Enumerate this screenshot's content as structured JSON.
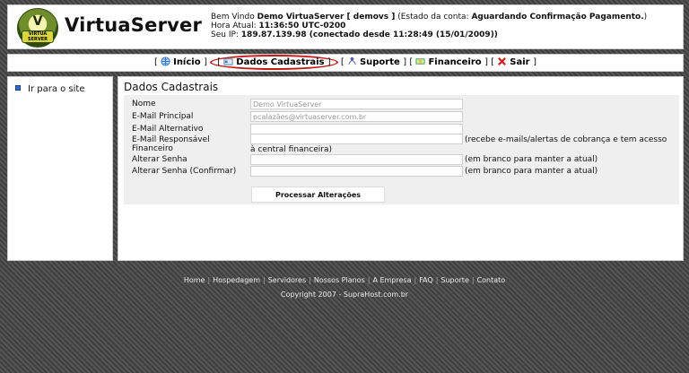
{
  "header": {
    "logo_badge": "VIRTUA SERVER",
    "logo_text": "VirtuaServer",
    "welcome_prefix": "Bem Vindo ",
    "user_name": "Demo VirtuaServer [ demovs ]",
    "status_prefix": " (Estado da conta: ",
    "status_value": "Aguardando Confirmação Pagamento.",
    "status_suffix": ")",
    "time_label": "Hora Atual: ",
    "time_value": "11:36:50 UTC-0200",
    "ip_label": "Seu IP: ",
    "ip_value": "189.87.139.98 (conectado desde 11:28:49 (15/01/2009))"
  },
  "nav": {
    "items": [
      {
        "label": "Início",
        "icon": "globe-icon",
        "color": "#2a6fd0"
      },
      {
        "label": "Dados Cadastrais",
        "icon": "card-icon",
        "color": "#4a7fb5"
      },
      {
        "label": "Suporte",
        "icon": "support-icon",
        "color": "#5a5ab5"
      },
      {
        "label": "Financeiro",
        "icon": "money-icon",
        "color": "#4aa040"
      },
      {
        "label": "Sair",
        "icon": "exit-icon",
        "color": "#d02020"
      }
    ],
    "active": "Dados Cadastrais",
    "highlight_color": "#c41a1a"
  },
  "sidebar": {
    "items": [
      {
        "label": "Ir para o site"
      }
    ]
  },
  "main": {
    "title": "Dados Cadastrais",
    "fields": [
      {
        "label": "Nome",
        "value": "Demo VirtuaServer"
      },
      {
        "label": "E-Mail Principal",
        "value": "pcalazães@virtuaserver.com.br"
      },
      {
        "label": "E-Mail Alternativo",
        "value": ""
      },
      {
        "label": "E-Mail Responsável Financeiro",
        "value": "",
        "note": "(recebe e-mails/alertas de cobrança e tem acesso à central financeira)"
      },
      {
        "label": "Alterar Senha",
        "value": "",
        "note": "(em branco para manter a atual)"
      },
      {
        "label": "Alterar Senha (Confirmar)",
        "value": "",
        "note": "(em branco para manter a atual)"
      }
    ],
    "submit_label": "Processar Alterações"
  },
  "footer": {
    "links": [
      "Home",
      "Hospedagem",
      "Servidores",
      "Nossos Planos",
      "A Empresa",
      "FAQ",
      "Suporte",
      "Contato"
    ],
    "copyright": "Copyright 2007 - SupraHost.com.br"
  }
}
